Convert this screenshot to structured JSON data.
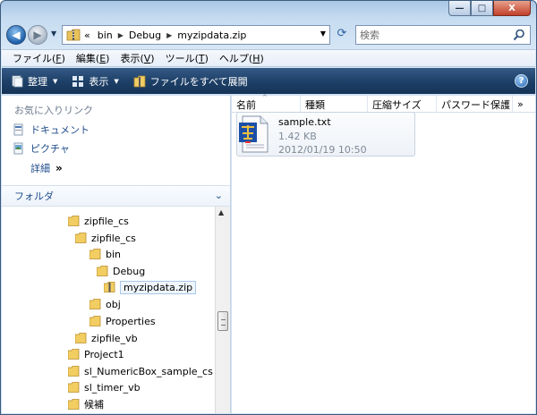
{
  "window": {
    "caption": {
      "minimize": "—",
      "maximize": "□",
      "close": "X"
    }
  },
  "nav": {
    "back_glyph": "◀",
    "forward_glyph": "▶",
    "breadcrumb": [
      "bin",
      "Debug",
      "myzipdata.zip"
    ],
    "breadcrumb_prefix": "«",
    "search_placeholder": "検索"
  },
  "menu": {
    "items": [
      {
        "label": "ファイル(",
        "key": "F",
        "end": ")"
      },
      {
        "label": "編集(",
        "key": "E",
        "end": ")"
      },
      {
        "label": "表示(",
        "key": "V",
        "end": ")"
      },
      {
        "label": "ツール(",
        "key": "T",
        "end": ")"
      },
      {
        "label": "ヘルプ(",
        "key": "H",
        "end": ")"
      }
    ]
  },
  "toolbar": {
    "organize": "整理",
    "views": "表示",
    "extract_all": "ファイルをすべて展開",
    "help": "?"
  },
  "sidebar": {
    "favorites_header": "お気に入りリンク",
    "favorites": [
      "ドキュメント",
      "ピクチャ"
    ],
    "more": "詳細",
    "more_glyph": "»",
    "folders_header": "フォルダ",
    "tree": [
      {
        "label": "zipfile_cs",
        "level": 0
      },
      {
        "label": "zipfile_cs",
        "level": 1
      },
      {
        "label": "bin",
        "level": 2
      },
      {
        "label": "Debug",
        "level": 3
      },
      {
        "label": "myzipdata.zip",
        "level": 4,
        "selected": true,
        "zip": true
      },
      {
        "label": "obj",
        "level": 2
      },
      {
        "label": "Properties",
        "level": 2
      },
      {
        "label": "zipfile_vb",
        "level": 0
      },
      {
        "label": "Project1",
        "level": -1
      },
      {
        "label": "sl_NumericBox_sample_cs",
        "level": -1
      },
      {
        "label": "sl_timer_vb",
        "level": -1
      },
      {
        "label": "候補",
        "level": -1
      }
    ]
  },
  "content": {
    "columns": [
      "名前",
      "種類",
      "圧縮サイズ",
      "パスワード保護",
      "»"
    ],
    "files": [
      {
        "name": "sample.txt",
        "size": "1.42 KB",
        "date": "2012/01/19 10:50"
      }
    ]
  }
}
